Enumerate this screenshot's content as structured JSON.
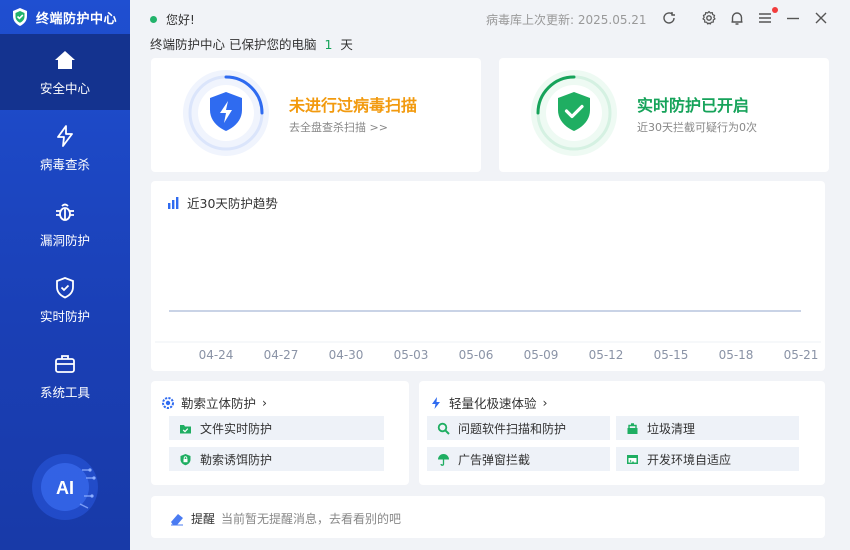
{
  "app": {
    "title": "终端防护中心"
  },
  "sidebar": {
    "items": [
      {
        "label": "安全中心",
        "icon": "home-icon",
        "active": true
      },
      {
        "label": "病毒查杀",
        "icon": "lightning-icon",
        "active": false
      },
      {
        "label": "漏洞防护",
        "icon": "bug-icon",
        "active": false
      },
      {
        "label": "实时防护",
        "icon": "shield-check-icon",
        "active": false
      },
      {
        "label": "系统工具",
        "icon": "toolbox-icon",
        "active": false
      }
    ],
    "ai_label": "AI"
  },
  "topbar": {
    "greeting": "您好!",
    "db_update": "病毒库上次更新: 2025.05.21",
    "icons": [
      "refresh-icon",
      "settings-icon",
      "bell-icon",
      "menu-icon",
      "minimize-icon",
      "close-icon"
    ]
  },
  "status": {
    "prefix": "终端防护中心 已保护您的电脑",
    "days": "1",
    "suffix": "天"
  },
  "scan_card": {
    "title": "未进行过病毒扫描",
    "subtitle": "去全盘查杀扫描 >>",
    "color": "#f29a0e"
  },
  "realtime_card": {
    "title": "实时防护已开启",
    "subtitle": "近30天拦截可疑行为0次",
    "color": "#16a35a"
  },
  "trend": {
    "title": "近30天防护趋势"
  },
  "chart_data": {
    "type": "line",
    "categories": [
      "04-24",
      "04-27",
      "04-30",
      "05-03",
      "05-06",
      "05-09",
      "05-12",
      "05-15",
      "05-18",
      "05-21"
    ],
    "series": [
      {
        "values": [
          0,
          0,
          0,
          0,
          0,
          0,
          0,
          0,
          0,
          0
        ]
      }
    ],
    "title": "近30天防护趋势",
    "grid": false
  },
  "ransom": {
    "title": "勒索立体防护",
    "items": [
      "文件实时防护",
      "勒索诱饵防护"
    ]
  },
  "lite": {
    "title": "轻量化极速体验",
    "items": [
      "问题软件扫描和防护",
      "垃圾清理",
      "广告弹窗拦截",
      "开发环境自适应"
    ]
  },
  "reminder": {
    "label": "提醒",
    "text": "当前暂无提醒消息，去看看别的吧"
  },
  "colors": {
    "sidebar": "#1f4fd1",
    "accent_blue": "#2f6bf0",
    "accent_green": "#16a35a",
    "accent_orange": "#f29a0e"
  }
}
